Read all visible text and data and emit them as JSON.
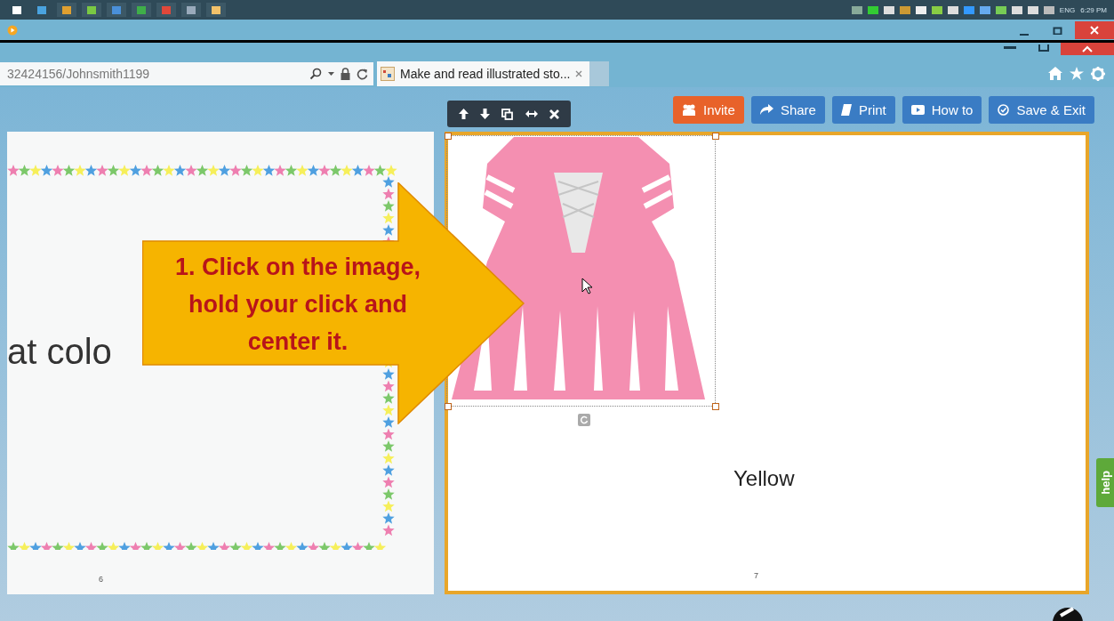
{
  "taskbar": {
    "language": "ENG",
    "time": "6:29 PM"
  },
  "browser": {
    "address": "32424156/Johnsmith1199",
    "tabs": [
      {
        "title": "Make and read illustrated sto...",
        "selected": true
      }
    ]
  },
  "toolbar": {
    "buttons": [
      {
        "label": "Invite",
        "kind": "invite",
        "color": "#e8622a"
      },
      {
        "label": "Share",
        "kind": "share",
        "color": "#3a7cc4"
      },
      {
        "label": "Print",
        "kind": "print",
        "color": "#3a7cc4"
      },
      {
        "label": "How to",
        "kind": "video",
        "color": "#3a7cc4"
      },
      {
        "label": "Save & Exit",
        "kind": "save",
        "color": "#3a7cc4"
      }
    ]
  },
  "pages": [
    {
      "number": "6",
      "text": "at colo",
      "kind": "stars",
      "selected": false
    },
    {
      "number": "7",
      "text": "Yellow",
      "kind": "image",
      "selected": true
    }
  ],
  "callout": {
    "text": "1. Click on the image, hold your click and center it."
  },
  "help_tab": {
    "label": "help"
  }
}
